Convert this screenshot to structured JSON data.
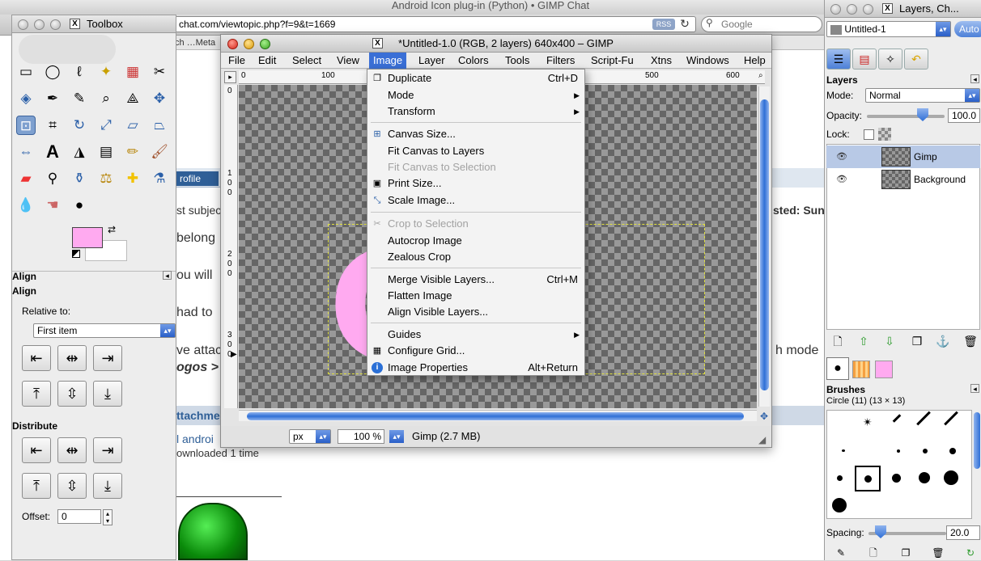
{
  "browser": {
    "title": "Android Icon plug-in (Python) • GIMP Chat",
    "url": "chat.com/viewtopic.php?f=9&t=1669",
    "rss": "RSS",
    "search_placeholder": "Google",
    "bookmarks": "ch …Meta",
    "profile_tab": "rofile",
    "text_subject": "st subjec",
    "text_posted": "sted: Sun I",
    "text_belong": "belong",
    "text_will": "ou will",
    "text_had": "had to",
    "text_attac": "ve attac",
    "text_logos": "ogos >",
    "text_mode": "h mode",
    "text_attachment": "ttachme",
    "text_android": "l androi",
    "text_downloaded": "ownloaded 1 time"
  },
  "toolbox": {
    "title": "Toolbox",
    "align_tab_title": "Align",
    "align_header": "Align",
    "relative_to_label": "Relative to:",
    "relative_to_value": "First item",
    "distribute_label": "Distribute",
    "offset_label": "Offset:",
    "offset_value": "0"
  },
  "image_window": {
    "title": "*Untitled-1.0 (RGB, 2 layers) 640x400 – GIMP",
    "menus": [
      "File",
      "Edit",
      "Select",
      "View",
      "Image",
      "Layer",
      "Colors",
      "Tools",
      "Filters",
      "Script-Fu",
      "Xtns",
      "Windows",
      "Help"
    ],
    "ruler_h": [
      "0",
      "100",
      "500",
      "600"
    ],
    "ruler_v": [
      "0",
      "1",
      "0",
      "0",
      "2",
      "0",
      "0",
      "3",
      "0",
      "0"
    ],
    "unit": "px",
    "zoom": "100 %",
    "status": "Gimp (2.7 MB)"
  },
  "image_menu": {
    "items": [
      {
        "label": "Duplicate",
        "shortcut": "Ctrl+D",
        "icon": "duplicate-icon",
        "disabled": false,
        "submenu": false
      },
      {
        "label": "Mode",
        "shortcut": "",
        "icon": "",
        "disabled": false,
        "submenu": true
      },
      {
        "label": "Transform",
        "shortcut": "",
        "icon": "",
        "disabled": false,
        "submenu": true
      },
      {
        "label": "Canvas Size...",
        "shortcut": "",
        "icon": "canvas-size-icon",
        "disabled": false,
        "submenu": false
      },
      {
        "label": "Fit Canvas to Layers",
        "shortcut": "",
        "icon": "",
        "disabled": false,
        "submenu": false
      },
      {
        "label": "Fit Canvas to Selection",
        "shortcut": "",
        "icon": "",
        "disabled": true,
        "submenu": false
      },
      {
        "label": "Print Size...",
        "shortcut": "",
        "icon": "print-size-icon",
        "disabled": false,
        "submenu": false
      },
      {
        "label": "Scale Image...",
        "shortcut": "",
        "icon": "scale-image-icon",
        "disabled": false,
        "submenu": false
      },
      {
        "label": "Crop to Selection",
        "shortcut": "",
        "icon": "crop-icon",
        "disabled": true,
        "submenu": false
      },
      {
        "label": "Autocrop Image",
        "shortcut": "",
        "icon": "",
        "disabled": false,
        "submenu": false
      },
      {
        "label": "Zealous Crop",
        "shortcut": "",
        "icon": "",
        "disabled": false,
        "submenu": false
      },
      {
        "label": "Merge Visible Layers...",
        "shortcut": "Ctrl+M",
        "icon": "",
        "disabled": false,
        "submenu": false
      },
      {
        "label": "Flatten Image",
        "shortcut": "",
        "icon": "",
        "disabled": false,
        "submenu": false
      },
      {
        "label": "Align Visible Layers...",
        "shortcut": "",
        "icon": "",
        "disabled": false,
        "submenu": false
      },
      {
        "label": "Guides",
        "shortcut": "",
        "icon": "",
        "disabled": false,
        "submenu": true
      },
      {
        "label": "Configure Grid...",
        "shortcut": "",
        "icon": "grid-icon",
        "disabled": false,
        "submenu": false
      },
      {
        "label": "Image Properties",
        "shortcut": "Alt+Return",
        "icon": "info-icon",
        "disabled": false,
        "submenu": false
      }
    ]
  },
  "dock": {
    "title": "Layers, Ch...",
    "image_select": "Untitled-1",
    "auto_label": "Auto",
    "layers_label": "Layers",
    "mode_label": "Mode:",
    "mode_value": "Normal",
    "opacity_label": "Opacity:",
    "opacity_value": "100.0",
    "lock_label": "Lock:",
    "layers": [
      {
        "name": "Gimp",
        "selected": true
      },
      {
        "name": "Background",
        "selected": false
      }
    ],
    "brushes_label": "Brushes",
    "brush_name": "Circle (11) (13 × 13)",
    "spacing_label": "Spacing:",
    "spacing_value": "20.0"
  },
  "colors": {
    "accent": "#3a6fd6",
    "foreground": "#ffaaf0",
    "background": "#ffffff"
  }
}
